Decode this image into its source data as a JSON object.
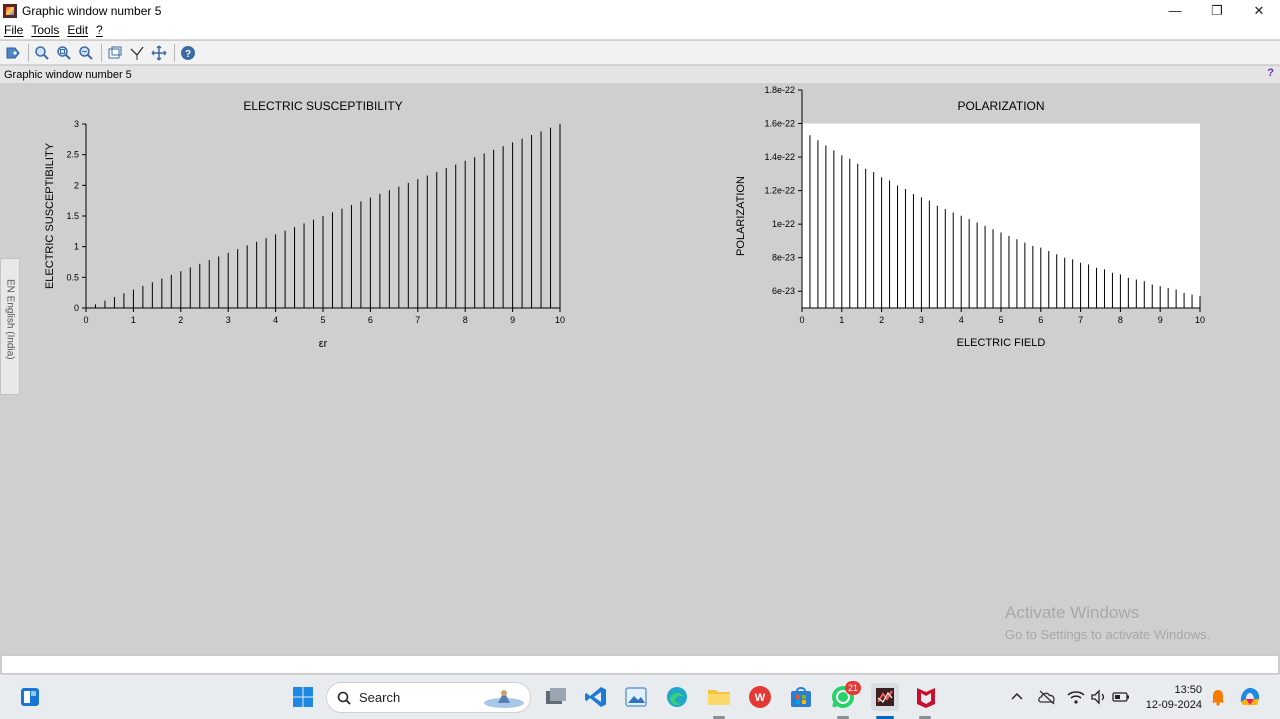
{
  "window": {
    "title": "Graphic window number 5",
    "controls": [
      "—",
      "❐",
      "✕"
    ]
  },
  "menu": {
    "items": [
      "File",
      "Tools",
      "Edit",
      "?"
    ]
  },
  "toolbar": {
    "icons": [
      "data-tip-icon",
      "zoom-in-icon",
      "zoom-reset-icon",
      "zoom-out-icon",
      "rotate-icon",
      "data-cursor-icon",
      "pan-icon",
      "help-icon"
    ]
  },
  "status": {
    "text": "Graphic window number 5",
    "help": "?"
  },
  "language_tab": {
    "text": "EN English (India)"
  },
  "watermark": {
    "line1": "Activate Windows",
    "line2": "Go to Settings to activate Windows."
  },
  "taskbar": {
    "search_label": "Search",
    "whatsapp_badge": "21",
    "time": "13:50",
    "date": "12-09-2024",
    "colors": {
      "accent": "#0067c0",
      "badge": "#e53935"
    }
  },
  "chart_data": [
    {
      "type": "bar",
      "title": "ELECTRIC SUSCEPTIBILITY",
      "xlabel": "εr",
      "ylabel": "ELECTRIC SUSCEPTIBILITY",
      "xlim": [
        0,
        10
      ],
      "ylim": [
        0,
        3
      ],
      "xticks": [
        "0",
        "1",
        "2",
        "3",
        "4",
        "5",
        "6",
        "7",
        "8",
        "9",
        "10"
      ],
      "yticks": [
        "0",
        "0.5",
        "1",
        "1.5",
        "2",
        "2.5",
        "3"
      ],
      "x_start": 0.0,
      "x_step": 0.2,
      "values": [
        0.0,
        0.06,
        0.12,
        0.18,
        0.24,
        0.3,
        0.36,
        0.42,
        0.48,
        0.54,
        0.6,
        0.66,
        0.72,
        0.78,
        0.84,
        0.9,
        0.96,
        1.02,
        1.08,
        1.14,
        1.2,
        1.26,
        1.32,
        1.38,
        1.44,
        1.5,
        1.56,
        1.62,
        1.68,
        1.74,
        1.8,
        1.86,
        1.92,
        1.98,
        2.04,
        2.1,
        2.16,
        2.22,
        2.28,
        2.34,
        2.4,
        2.46,
        2.52,
        2.58,
        2.64,
        2.7,
        2.76,
        2.82,
        2.88,
        2.94,
        3.0
      ],
      "grid": false
    },
    {
      "type": "bar",
      "title": "POLARIZATION",
      "xlabel": "ELECTRIC FIELD",
      "ylabel": "POLARIZATION",
      "xlim": [
        0,
        10
      ],
      "ylim": [
        5e-23,
        1.8e-22
      ],
      "xticks": [
        "0",
        "1",
        "2",
        "3",
        "4",
        "5",
        "6",
        "7",
        "8",
        "9",
        "10"
      ],
      "yticks": [
        "6e-23",
        "8e-23",
        "1e-22",
        "1.2e-22",
        "1.4e-22",
        "1.6e-22",
        "1.8e-22"
      ],
      "x_start": 0.2,
      "x_step": 0.2,
      "values": [
        1.53e-22,
        1.5e-22,
        1.47e-22,
        1.44e-22,
        1.41e-22,
        1.39e-22,
        1.36e-22,
        1.33e-22,
        1.31e-22,
        1.28e-22,
        1.26e-22,
        1.23e-22,
        1.21e-22,
        1.18e-22,
        1.16e-22,
        1.14e-22,
        1.11e-22,
        1.09e-22,
        1.07e-22,
        1.05e-22,
        1.03e-22,
        1.01e-22,
        9.9e-23,
        9.7e-23,
        9.5e-23,
        9.3e-23,
        9.1e-23,
        8.9e-23,
        8.7e-23,
        8.6e-23,
        8.4e-23,
        8.2e-23,
        8e-23,
        7.9e-23,
        7.7e-23,
        7.6e-23,
        7.4e-23,
        7.3e-23,
        7.1e-23,
        7e-23,
        6.8e-23,
        6.7e-23,
        6.6e-23,
        6.4e-23,
        6.3e-23,
        6.2e-23,
        6.1e-23,
        5.9e-23,
        5.8e-23,
        5.7e-23
      ],
      "plot_background": "#ffffff",
      "grid": false
    }
  ]
}
